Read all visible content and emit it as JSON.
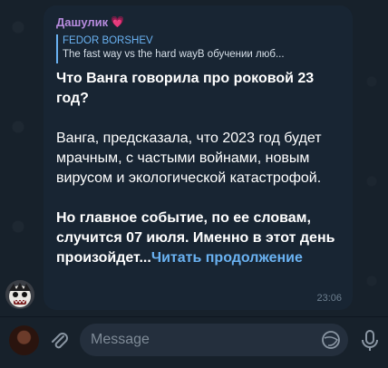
{
  "chat": {
    "sender_name": "Дашулик",
    "sender_emoji": "💗",
    "reply": {
      "author": "FEDOR BORSHEV",
      "snippet": "The fast way vs the hard wayВ обучении люб..."
    },
    "message": {
      "title": "Что Ванга говорила про роковой 23 год?",
      "paragraph1": "Ванга, предсказала, что 2023 год будет мрачным, с частыми войнами, новым вирусом и экологической катастрофой.",
      "paragraph2": "Но главное событие, по ее словам, случится 07 июля. Именно в этот день произойдет...",
      "read_more": "Читать продолжение",
      "time": "23:06"
    }
  },
  "composer": {
    "placeholder": "Message"
  },
  "colors": {
    "background": "#17212b",
    "bubble": "#182533",
    "accent": "#6ab2f2",
    "sender": "#b78bde"
  },
  "icons": [
    "attach-icon",
    "emoji-icon",
    "mic-icon",
    "heart-emoji"
  ]
}
